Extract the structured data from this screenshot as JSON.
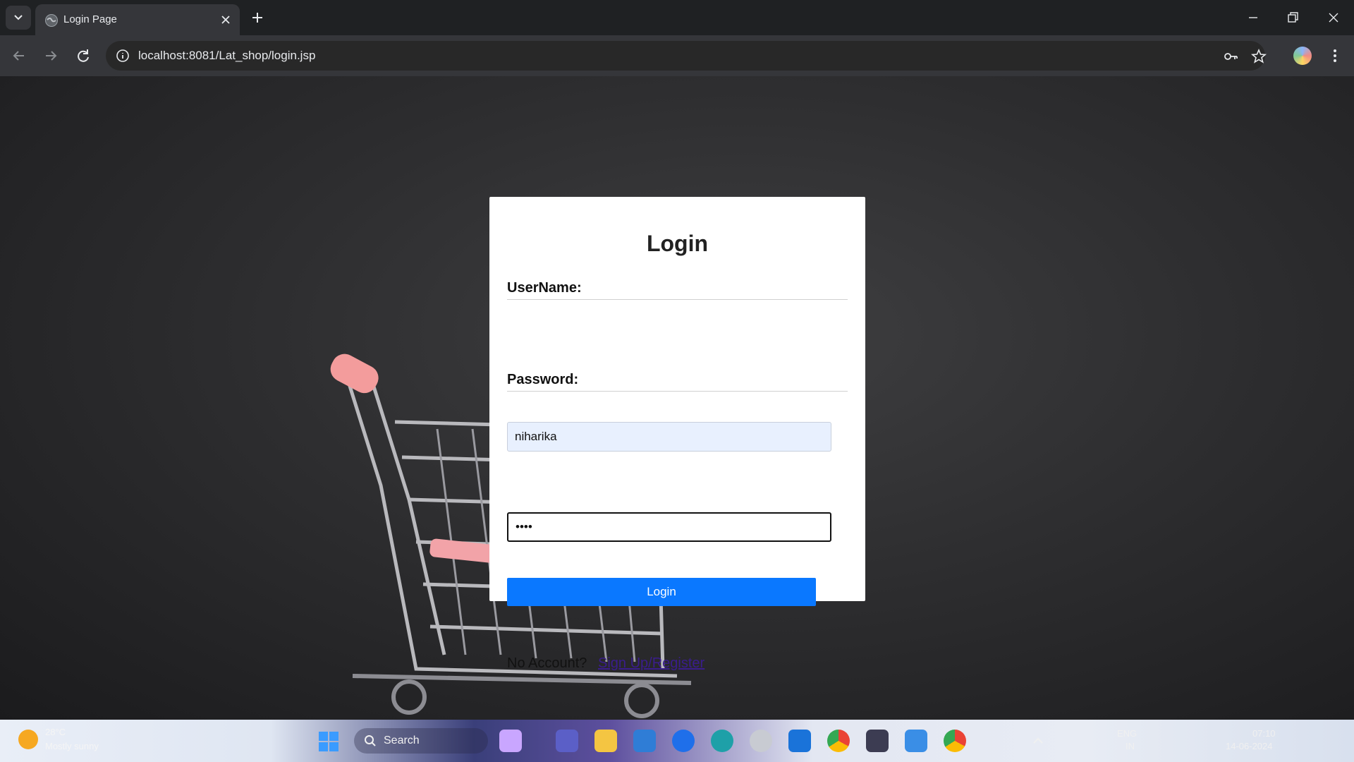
{
  "browser": {
    "tab_title": "Login Page",
    "url": "localhost:8081/Lat_shop/login.jsp"
  },
  "login": {
    "title": "Login",
    "username_label": "UserName:",
    "username_value": "niharika",
    "password_label": "Password:",
    "password_value": "abcd",
    "button_label": "Login",
    "no_account_text": "No Account?",
    "signup_link": "Sign Up/Register"
  },
  "taskbar": {
    "weather_temp": "28°C",
    "weather_desc": "Mostly sunny",
    "search_label": "Search",
    "apps": [
      "widgets",
      "teams",
      "file-explorer",
      "photos",
      "zoom",
      "edge",
      "dell",
      "mail",
      "chrome",
      "terminal",
      "notepad",
      "chrome-dev"
    ],
    "lang_1": "ENG",
    "lang_2": "IN",
    "time": "07:10",
    "date": "14-06-2024"
  },
  "colors": {
    "accent": "#0a78ff",
    "link": "#3a1d8c",
    "autofill": "#e8f0fe"
  }
}
